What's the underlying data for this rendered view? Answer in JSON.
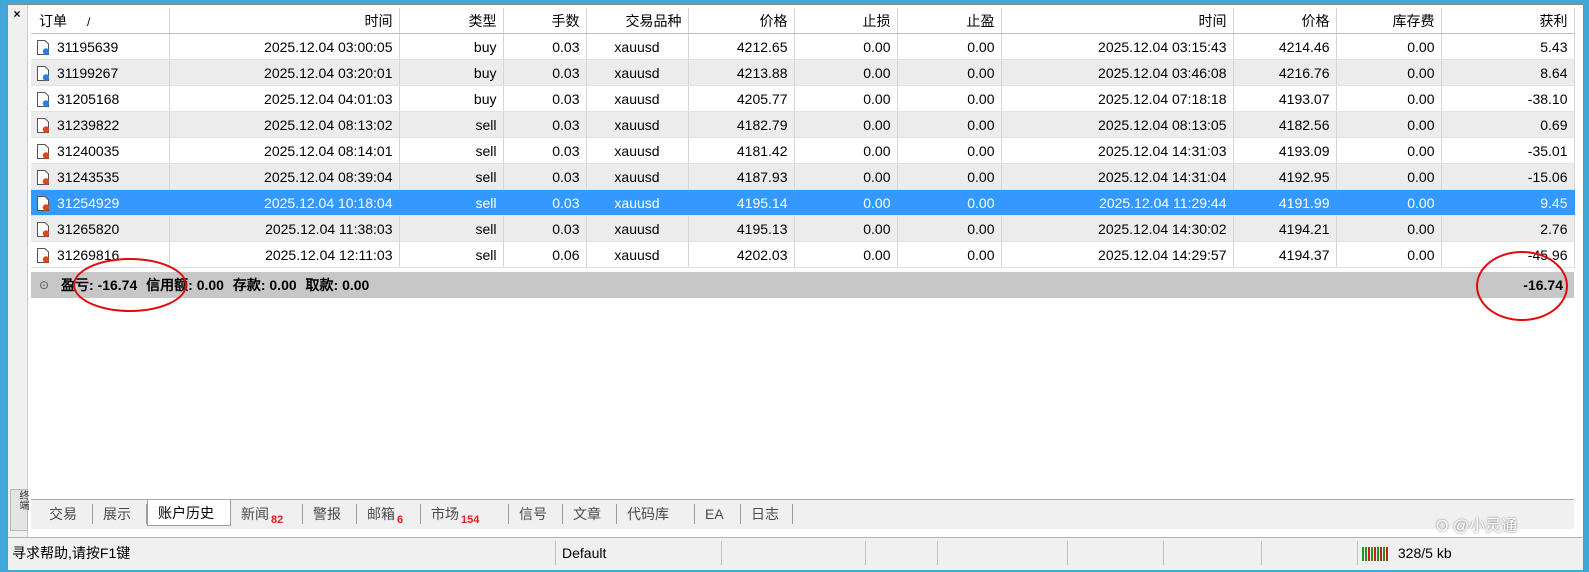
{
  "window": {
    "close_label": "×",
    "side_label": "终端"
  },
  "table": {
    "columns": [
      "订单",
      "时间",
      "类型",
      "手数",
      "交易品种",
      "价格",
      "止损",
      "止盈",
      "时间",
      "价格",
      "库存费",
      "获利"
    ],
    "sort_mark": "/",
    "rows": [
      {
        "order": "31195639",
        "open_time": "2025.12.04 03:00:05",
        "type": "buy",
        "lots": "0.03",
        "symbol": "xauusd",
        "open_price": "4212.65",
        "sl": "0.00",
        "tp": "0.00",
        "close_time": "2025.12.04 03:15:43",
        "close_price": "4214.46",
        "swap": "0.00",
        "profit": "5.43",
        "icon_color": "#2a7ee0"
      },
      {
        "order": "31199267",
        "open_time": "2025.12.04 03:20:01",
        "type": "buy",
        "lots": "0.03",
        "symbol": "xauusd",
        "open_price": "4213.88",
        "sl": "0.00",
        "tp": "0.00",
        "close_time": "2025.12.04 03:46:08",
        "close_price": "4216.76",
        "swap": "0.00",
        "profit": "8.64",
        "icon_color": "#2a7ee0"
      },
      {
        "order": "31205168",
        "open_time": "2025.12.04 04:01:03",
        "type": "buy",
        "lots": "0.03",
        "symbol": "xauusd",
        "open_price": "4205.77",
        "sl": "0.00",
        "tp": "0.00",
        "close_time": "2025.12.04 07:18:18",
        "close_price": "4193.07",
        "swap": "0.00",
        "profit": "-38.10",
        "icon_color": "#2a7ee0"
      },
      {
        "order": "31239822",
        "open_time": "2025.12.04 08:13:02",
        "type": "sell",
        "lots": "0.03",
        "symbol": "xauusd",
        "open_price": "4182.79",
        "sl": "0.00",
        "tp": "0.00",
        "close_time": "2025.12.04 08:13:05",
        "close_price": "4182.56",
        "swap": "0.00",
        "profit": "0.69",
        "icon_color": "#e0441a"
      },
      {
        "order": "31240035",
        "open_time": "2025.12.04 08:14:01",
        "type": "sell",
        "lots": "0.03",
        "symbol": "xauusd",
        "open_price": "4181.42",
        "sl": "0.00",
        "tp": "0.00",
        "close_time": "2025.12.04 14:31:03",
        "close_price": "4193.09",
        "swap": "0.00",
        "profit": "-35.01",
        "icon_color": "#e0441a"
      },
      {
        "order": "31243535",
        "open_time": "2025.12.04 08:39:04",
        "type": "sell",
        "lots": "0.03",
        "symbol": "xauusd",
        "open_price": "4187.93",
        "sl": "0.00",
        "tp": "0.00",
        "close_time": "2025.12.04 14:31:04",
        "close_price": "4192.95",
        "swap": "0.00",
        "profit": "-15.06",
        "icon_color": "#e0441a"
      },
      {
        "order": "31254929",
        "open_time": "2025.12.04 10:18:04",
        "type": "sell",
        "lots": "0.03",
        "symbol": "xauusd",
        "open_price": "4195.14",
        "sl": "0.00",
        "tp": "0.00",
        "close_time": "2025.12.04 11:29:44",
        "close_price": "4191.99",
        "swap": "0.00",
        "profit": "9.45",
        "icon_color": "#e0441a",
        "selected": true
      },
      {
        "order": "31265820",
        "open_time": "2025.12.04 11:38:03",
        "type": "sell",
        "lots": "0.03",
        "symbol": "xauusd",
        "open_price": "4195.13",
        "sl": "0.00",
        "tp": "0.00",
        "close_time": "2025.12.04 14:30:02",
        "close_price": "4194.21",
        "swap": "0.00",
        "profit": "2.76",
        "icon_color": "#e0441a"
      },
      {
        "order": "31269816",
        "open_time": "2025.12.04 12:11:03",
        "type": "sell",
        "lots": "0.06",
        "symbol": "xauusd",
        "open_price": "4202.03",
        "sl": "0.00",
        "tp": "0.00",
        "close_time": "2025.12.04 14:29:57",
        "close_price": "4194.37",
        "swap": "0.00",
        "profit": "-45.96",
        "icon_color": "#e0441a"
      }
    ]
  },
  "summary": {
    "icon": "⊙",
    "profit_label": "盈亏: -16.74",
    "credit_label": "信用额: 0.00",
    "deposit_label": "存款: 0.00",
    "withdraw_label": "取款: 0.00",
    "total": "-16.74"
  },
  "tabs": [
    {
      "label": "交易"
    },
    {
      "label": "展示"
    },
    {
      "label": "账户历史",
      "active": true
    },
    {
      "label": "新闻",
      "badge": "82"
    },
    {
      "label": "警报"
    },
    {
      "label": "邮箱",
      "badge": "6"
    },
    {
      "label": "市场",
      "badge": "154"
    },
    {
      "label": "信号"
    },
    {
      "label": "文章"
    },
    {
      "label": "代码库"
    },
    {
      "label": "EA"
    },
    {
      "label": "日志"
    }
  ],
  "status": {
    "help_text": "寻求帮助,请按F1键",
    "profile": "Default",
    "traffic": "328/5 kb"
  },
  "watermark": "@小灵通",
  "colors": {
    "selection": "#3399ff",
    "annotation": "#e10a0a",
    "buy_icon": "#2a7ee0",
    "sell_icon": "#e0441a"
  }
}
